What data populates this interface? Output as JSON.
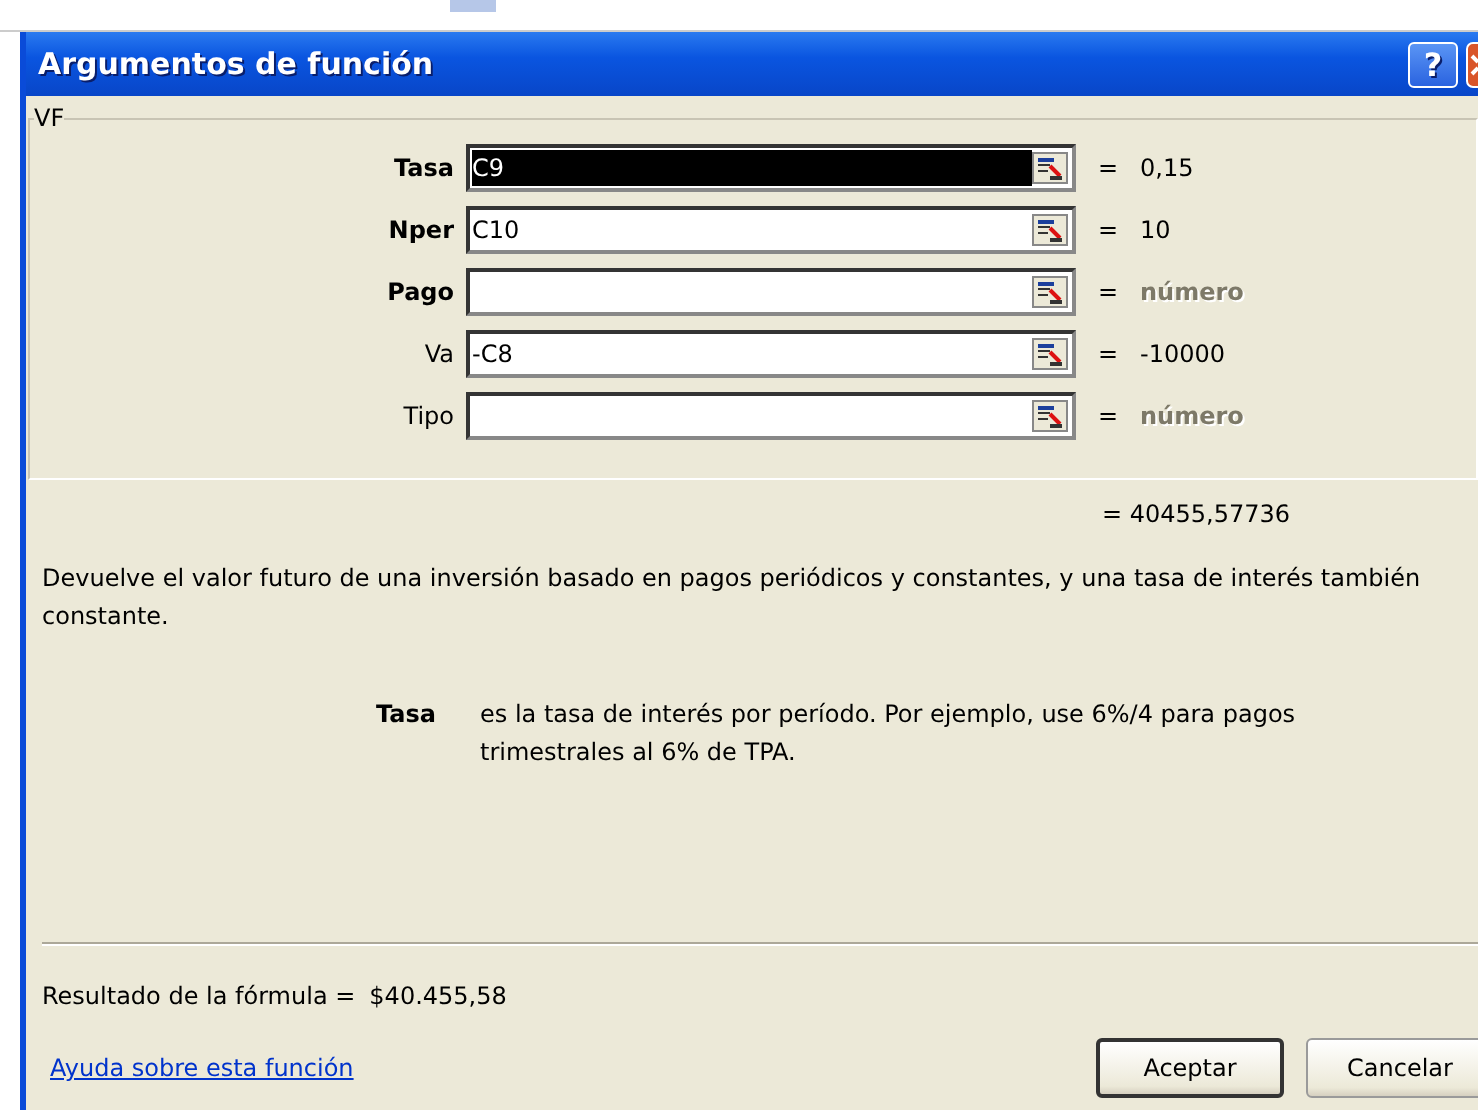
{
  "window": {
    "title": "Argumentos de función",
    "buttons": [
      "?"
    ]
  },
  "function_group": {
    "name": "VF"
  },
  "arguments": [
    {
      "label": "Tasa",
      "required": true,
      "value": "C9",
      "selected": true,
      "equals": "=",
      "result": {
        "text": "0,15",
        "kind": "value"
      }
    },
    {
      "label": "Nper",
      "required": true,
      "value": "C10",
      "selected": false,
      "equals": "=",
      "result": {
        "text": "10",
        "kind": "value"
      }
    },
    {
      "label": "Pago",
      "required": true,
      "selected": false,
      "equals": "=",
      "result": {
        "text": "número",
        "kind": "hint"
      }
    },
    {
      "label": "Va",
      "required": false,
      "value": "-C8",
      "selected": false,
      "equals": "=",
      "result": {
        "text": "-10000",
        "kind": "value"
      }
    },
    {
      "label": "Tipo",
      "required": false,
      "selected": false,
      "equals": "=",
      "result": {
        "text": "número",
        "kind": "hint"
      }
    }
  ],
  "function_result": "= 40455,57736",
  "description": "Devuelve el valor futuro de una inversión basado en pagos periódicos y constantes, y una tasa de interés también constante.",
  "argument_help": {
    "name": "Tasa",
    "text": "es la tasa de interés por período. Por ejemplo, use 6%/4 para pagos trimestrales al 6% de TPA."
  },
  "formula_result": {
    "label": "Resultado de la fórmula =",
    "value": "$40.455,58"
  },
  "help_link": "Ayuda sobre esta función",
  "buttons": [
    {
      "label": "Aceptar",
      "default": true
    },
    {
      "label": "Cancelar",
      "default": false
    }
  ]
}
